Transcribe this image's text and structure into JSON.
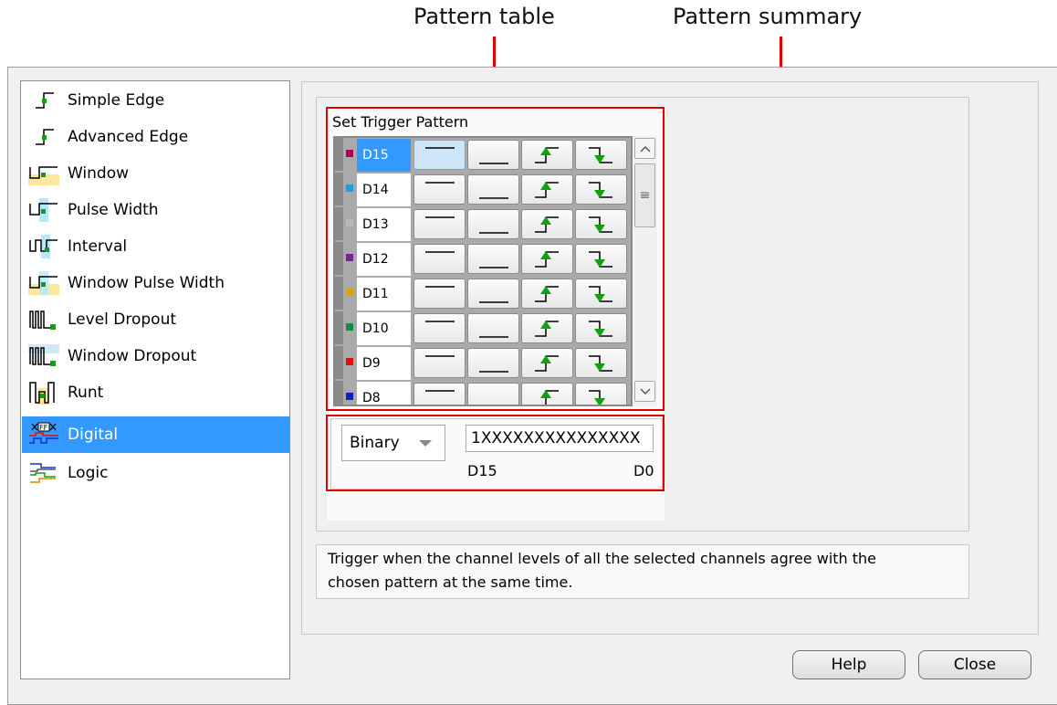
{
  "callouts": {
    "pattern_table": "Pattern table",
    "pattern_summary": "Pattern summary"
  },
  "trigger_types": [
    {
      "label": "Simple Edge",
      "icon": "simple-edge-icon"
    },
    {
      "label": "Advanced Edge",
      "icon": "advanced-edge-icon"
    },
    {
      "label": "Window",
      "icon": "window-icon"
    },
    {
      "label": "Pulse Width",
      "icon": "pulse-width-icon"
    },
    {
      "label": "Interval",
      "icon": "interval-icon"
    },
    {
      "label": "Window Pulse Width",
      "icon": "window-pulse-width-icon"
    },
    {
      "label": "Level Dropout",
      "icon": "level-dropout-icon"
    },
    {
      "label": "Window Dropout",
      "icon": "window-dropout-icon"
    },
    {
      "label": "Runt",
      "icon": "runt-icon"
    },
    {
      "label": "Digital",
      "icon": "digital-icon",
      "selected": true
    },
    {
      "label": "Logic",
      "icon": "logic-icon"
    }
  ],
  "pattern": {
    "title": "Set Trigger Pattern",
    "channels": [
      {
        "name": "D15",
        "color": "#b0005a",
        "selected": true
      },
      {
        "name": "D14",
        "color": "#1aa0e0"
      },
      {
        "name": "D13",
        "color": "#b8b8b8"
      },
      {
        "name": "D12",
        "color": "#7a1fa0"
      },
      {
        "name": "D11",
        "color": "#e0a000"
      },
      {
        "name": "D10",
        "color": "#109040"
      },
      {
        "name": "D9",
        "color": "#e01010"
      },
      {
        "name": "D8",
        "color": "#1020c0"
      }
    ],
    "button_icons": [
      "high-level-icon",
      "low-level-icon",
      "rising-edge-icon",
      "falling-edge-icon"
    ],
    "selected_button": "high-level-icon"
  },
  "summary": {
    "format": "Binary",
    "value": "1XXXXXXXXXXXXXXX",
    "msb_label": "D15",
    "lsb_label": "D0"
  },
  "description": {
    "line1": "Trigger when the channel levels of all the selected channels agree with the",
    "line2": "chosen pattern at the same time."
  },
  "buttons": {
    "help": "Help",
    "close": "Close"
  },
  "colors": {
    "selection": "#3399ff",
    "callout_red": "#e00000",
    "edge_green": "#10a010"
  }
}
